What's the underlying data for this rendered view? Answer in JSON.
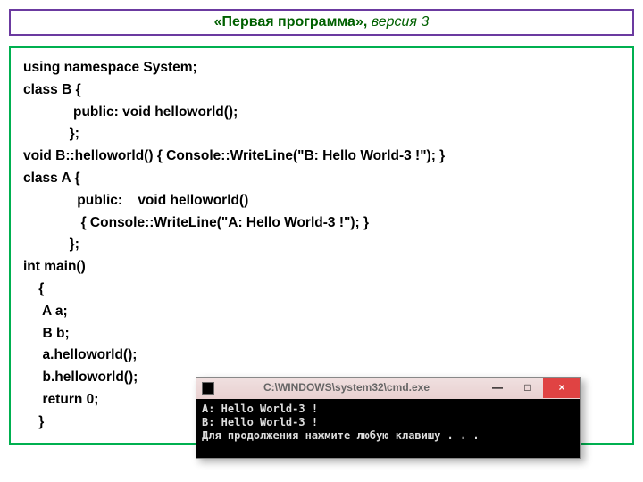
{
  "title": {
    "quoted": "«Первая программа», ",
    "version": "версия 3"
  },
  "code": "using namespace System;\nclass B {\n             public: void helloworld();\n            };\nvoid B::helloworld() { Console::WriteLine(\"B: Hello World-3 !\"); }\nclass A {\n              public:    void helloworld()\n               { Console::WriteLine(\"A: Hello World-3 !\"); }\n            };\nint main()\n    {\n     A a;\n     B b;\n     a.helloworld();\n     b.helloworld();\n     return 0;\n    }",
  "cmd": {
    "title": "C:\\WINDOWS\\system32\\cmd.exe",
    "buttons": {
      "min": "—",
      "max": "□",
      "close": "×"
    },
    "output": "A: Hello World-3 !\nB: Hello World-3 !\nДля продолжения нажмите любую клавишу . . ."
  }
}
